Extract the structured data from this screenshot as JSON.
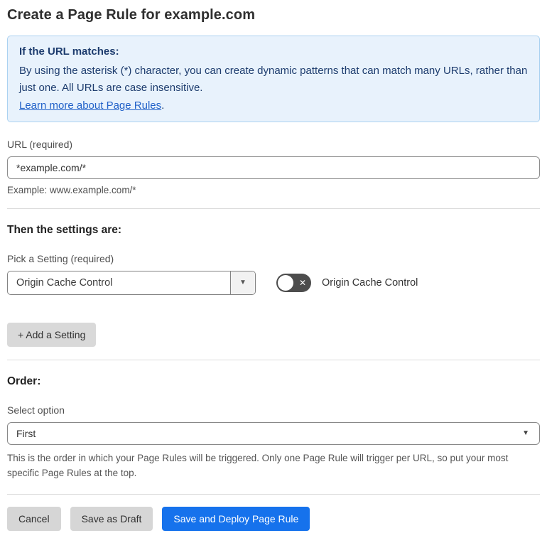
{
  "page": {
    "title": "Create a Page Rule for example.com"
  },
  "info_box": {
    "heading": "If the URL matches:",
    "body": "By using the asterisk (*) character, you can create dynamic patterns that can match many URLs, rather than just one. All URLs are case insensitive.",
    "link_label": "Learn more about Page Rules",
    "link_suffix": "."
  },
  "url_field": {
    "label": "URL (required)",
    "value": "*example.com/*",
    "example": "Example: www.example.com/*"
  },
  "settings": {
    "heading": "Then the settings are:",
    "pick_label": "Pick a Setting (required)",
    "selected_setting": "Origin Cache Control",
    "toggle_state": "off",
    "toggle_label": "Origin Cache Control",
    "add_button_label": "+ Add a Setting"
  },
  "order": {
    "heading": "Order:",
    "select_label": "Select option",
    "selected_option": "First",
    "help_text": "This is the order in which your Page Rules will be triggered. Only one Page Rule will trigger per URL, so put your most specific Page Rules at the top."
  },
  "footer": {
    "cancel_label": "Cancel",
    "save_draft_label": "Save as Draft",
    "save_deploy_label": "Save and Deploy Page Rule"
  },
  "icons": {
    "dropdown_caret": "▼",
    "toggle_off_x": "✕"
  },
  "colors": {
    "primary_blue": "#1672ec",
    "info_bg": "#e8f2fc",
    "info_border": "#abd2f1",
    "info_text": "#1d3c6e",
    "link_blue": "#2262c9",
    "toggle_bg": "#4d4d4d",
    "button_gray": "#d6d6d6"
  }
}
